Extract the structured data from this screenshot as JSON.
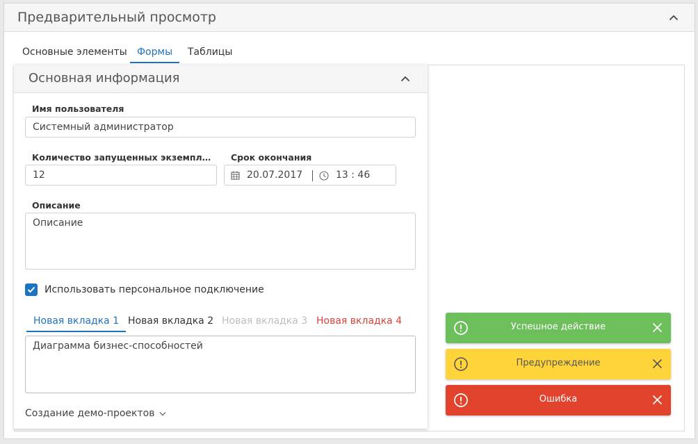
{
  "panel": {
    "title": "Предварительный просмотр"
  },
  "tabs": [
    {
      "label": "Основные элементы"
    },
    {
      "label": "Формы"
    },
    {
      "label": "Таблицы"
    }
  ],
  "card": {
    "title": "Основная информация",
    "username_label": "Имя пользователя",
    "username_value": "Системный администратор",
    "instances_label": "Количество запущенных экземпляров",
    "instances_value": "12",
    "deadline_label": "Срок окончания",
    "deadline_date": "20.07.2017",
    "deadline_time": "13 : 46",
    "description_label": "Описание",
    "description_value": "Описание",
    "checkbox_label": "Использовать персональное подключение",
    "inner_tabs": [
      {
        "label": "Новая вкладка 1"
      },
      {
        "label": "Новая вкладка 2"
      },
      {
        "label": "Новая вкладка 3"
      },
      {
        "label": "Новая вкладка 4"
      }
    ],
    "inner_tab_content": "Диаграмма бизнес-способностей",
    "footer_link": "Создание демо-проектов"
  },
  "toasts": [
    {
      "text": "Успешное действие",
      "color": "#6dbf5b"
    },
    {
      "text": "Предупреждение",
      "color": "#ffd43a"
    },
    {
      "text": "Ошибка",
      "color": "#e2432d"
    }
  ],
  "colors": {
    "accent": "#1e73be",
    "danger_text": "#d9423a",
    "disabled_text": "#bdbdbd"
  }
}
